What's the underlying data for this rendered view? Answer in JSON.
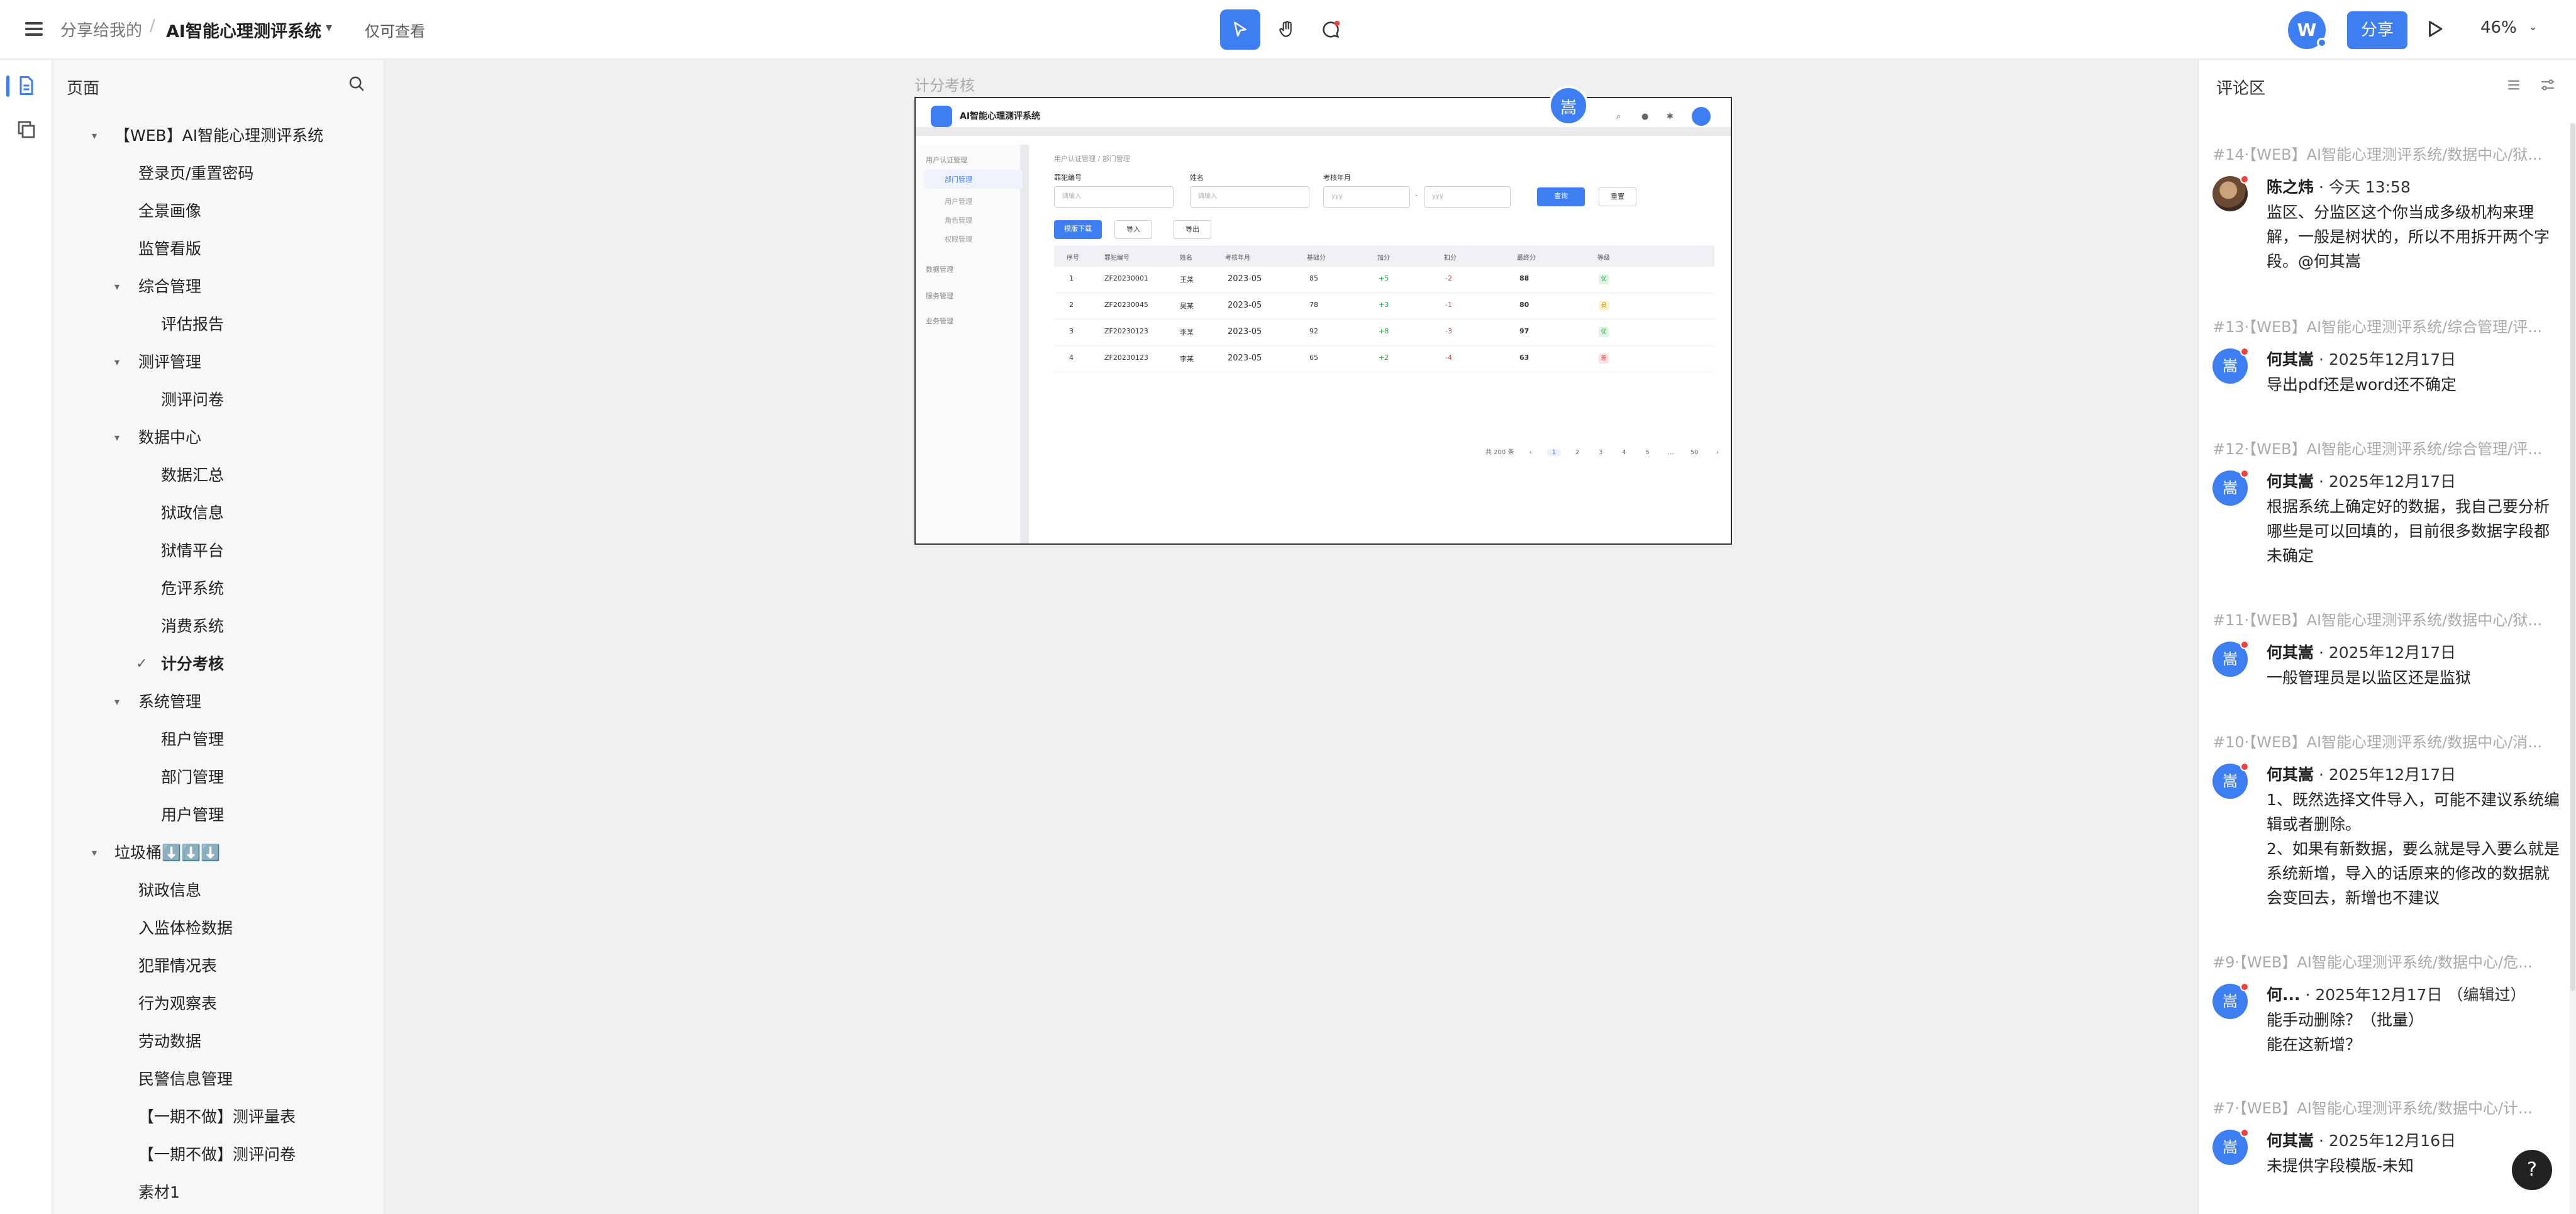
{
  "topbar": {
    "breadcrumb": "分享给我的",
    "separator": "/",
    "title": "AI智能心理测评系统",
    "permission": "仅可查看",
    "avatar_letter": "W",
    "share_label": "分享",
    "zoom": "46%",
    "accent": "#3d7ef2"
  },
  "sidebar": {
    "heading": "页面",
    "items": [
      {
        "label": "【WEB】AI智能心理测评系统"
      },
      {
        "label": "登录页/重置密码"
      },
      {
        "label": "全景画像"
      },
      {
        "label": "监管看版"
      },
      {
        "label": "综合管理"
      },
      {
        "label": "评估报告"
      },
      {
        "label": "测评管理"
      },
      {
        "label": "测评问卷"
      },
      {
        "label": "数据中心"
      },
      {
        "label": "数据汇总"
      },
      {
        "label": "狱政信息"
      },
      {
        "label": "狱情平台"
      },
      {
        "label": "危评系统"
      },
      {
        "label": "消费系统"
      },
      {
        "label": "计分考核"
      },
      {
        "label": "系统管理"
      },
      {
        "label": "租户管理"
      },
      {
        "label": "部门管理"
      },
      {
        "label": "用户管理"
      },
      {
        "label": "垃圾桶⬇️⬇️⬇️"
      },
      {
        "label": "狱政信息"
      },
      {
        "label": "入监体检数据"
      },
      {
        "label": "犯罪情况表"
      },
      {
        "label": "行为观察表"
      },
      {
        "label": "劳动数据"
      },
      {
        "label": "民警信息管理"
      },
      {
        "label": "【一期不做】测评量表"
      },
      {
        "label": "【一期不做】测评问卷"
      },
      {
        "label": "素材1"
      }
    ]
  },
  "canvas": {
    "frame_label": "计分考核",
    "collab_badge": "嵩",
    "app_title": "AI智能心理测评系统",
    "side_menu": [
      {
        "label": "用户认证管理"
      },
      {
        "label": "部门管理"
      },
      {
        "label": "用户管理"
      },
      {
        "label": "角色管理"
      },
      {
        "label": "权限管理"
      },
      {
        "label": "数据管理"
      },
      {
        "label": "服务管理"
      },
      {
        "label": "业务管理"
      }
    ],
    "breadcrumb": "用户认证管理 / 部门管理",
    "filters": {
      "label1": "罪犯编号",
      "ph1": "请输入",
      "label2": "姓名",
      "ph2": "请输入",
      "label3": "考核年月",
      "ph3": "yyy",
      "ph4": "yyy",
      "range_sep": "-",
      "query": "查询",
      "reset": "重置"
    },
    "buttons": {
      "template": "模版下载",
      "import": "导入",
      "export": "导出"
    },
    "table_headers": [
      "序号",
      "罪犯编号",
      "姓名",
      "考核年月",
      "基础分",
      "加分",
      "扣分",
      "最终分",
      "等级"
    ],
    "rows": [
      [
        "1",
        "ZF20230001",
        "王某",
        "2023-05",
        "85",
        "+5",
        "-2",
        "88",
        "优"
      ],
      [
        "2",
        "ZF20230045",
        "吴某",
        "2023-05",
        "78",
        "+3",
        "-1",
        "80",
        "良"
      ],
      [
        "3",
        "ZF20230123",
        "李某",
        "2023-05",
        "92",
        "+8",
        "-3",
        "97",
        "优"
      ],
      [
        "4",
        "ZF20230123",
        "李某",
        "2023-05",
        "65",
        "+2",
        "-4",
        "63",
        "差"
      ]
    ],
    "pager": [
      "共 200 条",
      "‹",
      "1",
      "2",
      "3",
      "4",
      "5",
      "…",
      "50",
      "›"
    ]
  },
  "comments": {
    "heading": "评论区",
    "items": [
      {
        "ref": "#14·【WEB】AI智能心理测评系统/数据中心/狱...",
        "author": "陈之炜",
        "time": "· 今天 13:58",
        "avatar": "",
        "body": "监区、分监区这个你当成多级机构来理解，一般是树状的，所以不用拆开两个字段。@何其嵩"
      },
      {
        "ref": "#13·【WEB】AI智能心理测评系统/综合管理/评...",
        "author": "何其嵩",
        "time": "· 2025年12月17日",
        "avatar": "嵩",
        "body": "导出pdf还是word还不确定"
      },
      {
        "ref": "#12·【WEB】AI智能心理测评系统/综合管理/评...",
        "author": "何其嵩",
        "time": "· 2025年12月17日",
        "avatar": "嵩",
        "body": "根据系统上确定好的数据，我自己要分析哪些是可以回填的，目前很多数据字段都未确定"
      },
      {
        "ref": "#11·【WEB】AI智能心理测评系统/数据中心/狱...",
        "author": "何其嵩",
        "time": "· 2025年12月17日",
        "avatar": "嵩",
        "body": "一般管理员是以监区还是监狱"
      },
      {
        "ref": "#10·【WEB】AI智能心理测评系统/数据中心/消...",
        "author": "何其嵩",
        "time": "· 2025年12月17日",
        "avatar": "嵩",
        "body": "1、既然选择文件导入，可能不建议系统编辑或者删除。\n2、如果有新数据，要么就是导入要么就是系统新增，导入的话原来的修改的数据就会变回去，新增也不建议"
      },
      {
        "ref": "#9·【WEB】AI智能心理测评系统/数据中心/危...",
        "author": "何...",
        "time": "· 2025年12月17日 （编辑过）",
        "avatar": "嵩",
        "body": "能手动删除？（批量）\n能在这新增？"
      },
      {
        "ref": "#7·【WEB】AI智能心理测评系统/数据中心/计...",
        "author": "何其嵩",
        "time": "· 2025年12月16日",
        "avatar": "嵩",
        "body": "未提供字段模版-未知"
      }
    ]
  },
  "help_label": "?"
}
